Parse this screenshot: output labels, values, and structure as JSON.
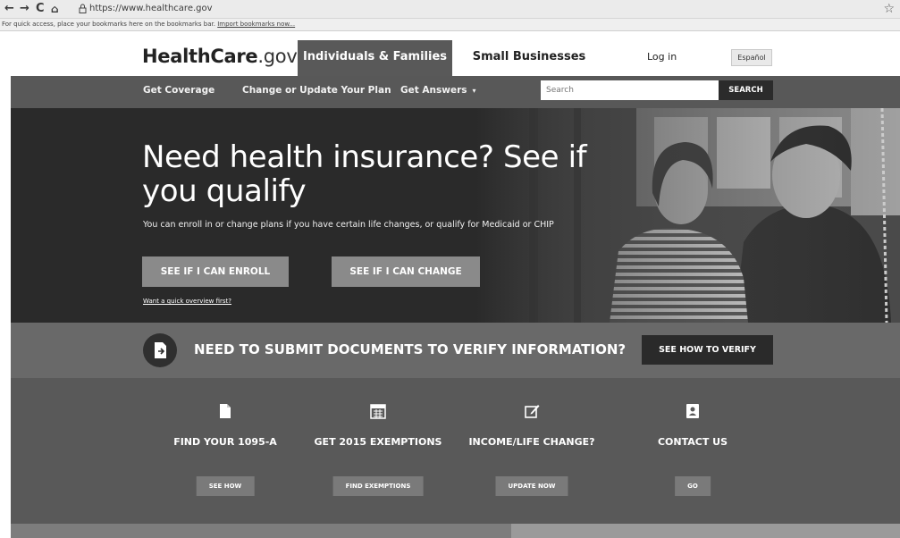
{
  "browser": {
    "url": "https://www.healthcare.gov",
    "bookmarks_text": "For quick access, place your bookmarks here on the bookmarks bar.",
    "bookmarks_link": "Import bookmarks now..."
  },
  "header": {
    "logo_main": "HealthCare",
    "logo_suffix": ".gov",
    "tab_individuals": "Individuals & Families",
    "tab_small_business": "Small Businesses",
    "login": "Log in",
    "espanol": "Español"
  },
  "nav": {
    "get_coverage": "Get Coverage",
    "change_plan": "Change or Update Your Plan",
    "get_answers": "Get Answers",
    "search_placeholder": "Search",
    "search_button": "SEARCH"
  },
  "hero": {
    "title": "Need health insurance? See if you qualify",
    "subtitle": "You can enroll in or change plans if you have certain life changes, or qualify for Medicaid or CHIP",
    "enroll_button": "SEE IF I CAN ENROLL",
    "change_button": "SEE IF I CAN CHANGE",
    "overview_link": "Want a quick overview first?"
  },
  "verify": {
    "text": "NEED TO SUBMIT DOCUMENTS TO VERIFY INFORMATION?",
    "button": "SEE HOW TO VERIFY"
  },
  "features": [
    {
      "title": "FIND YOUR 1095-A",
      "button": "SEE HOW",
      "icon": "document-icon"
    },
    {
      "title": "GET 2015 EXEMPTIONS",
      "button": "FIND EXEMPTIONS",
      "icon": "calendar-icon"
    },
    {
      "title": "INCOME/LIFE CHANGE?",
      "button": "UPDATE NOW",
      "icon": "edit-icon"
    },
    {
      "title": "CONTACT US",
      "button": "GO",
      "icon": "contact-card-icon"
    }
  ]
}
